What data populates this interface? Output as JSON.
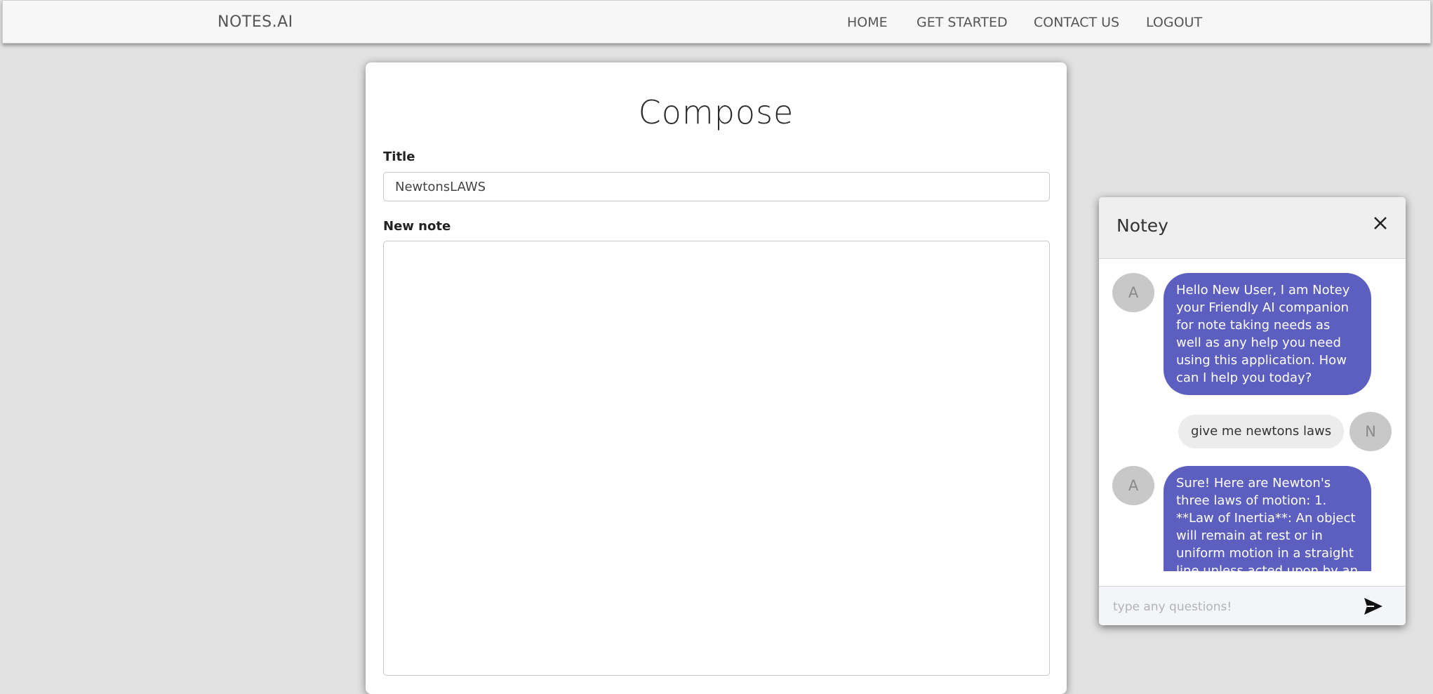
{
  "navbar": {
    "brand": "NOTES.AI",
    "links": [
      {
        "label": "HOME"
      },
      {
        "label": "GET STARTED"
      },
      {
        "label": "CONTACT US"
      },
      {
        "label": "LOGOUT"
      }
    ]
  },
  "compose": {
    "heading": "Compose",
    "title_label": "Title",
    "title_value": "NewtonsLAWS",
    "note_label": "New note",
    "note_value": ""
  },
  "chat": {
    "name": "Notey",
    "close_icon": "close-icon",
    "send_icon": "send-icon",
    "input_placeholder": "type any questions!",
    "messages": [
      {
        "sender": "bot",
        "avatar": "A",
        "text": "Hello New User, I am Notey your Friendly AI companion for note taking needs as well as any help you need using this application. How can I help you today?"
      },
      {
        "sender": "user",
        "avatar": "N",
        "text": "give me newtons laws"
      },
      {
        "sender": "bot",
        "avatar": "A",
        "text": "Sure! Here are Newton's three laws of motion: 1. **Law of Inertia**: An object will remain at rest or in uniform motion in a straight line unless acted upon by an external force."
      }
    ]
  },
  "colors": {
    "bot_bubble": "#5c5fbf",
    "user_bubble": "#ececec",
    "page_bg": "#e2e2e2"
  }
}
